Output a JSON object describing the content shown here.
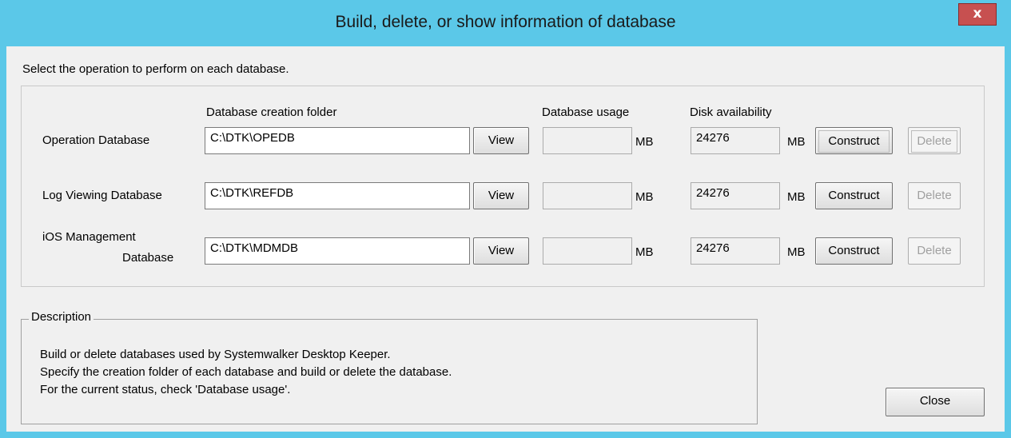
{
  "window": {
    "title": "Build, delete, or show information of database",
    "close_glyph": "x"
  },
  "instruction": "Select the operation to perform on each database.",
  "columns": {
    "folder": "Database creation folder",
    "usage": "Database usage",
    "disk": "Disk availability"
  },
  "rows": [
    {
      "label_line1": "Operation Database",
      "label_line2": "",
      "folder": "C:\\DTK\\OPEDB",
      "view_label": "View",
      "usage": "",
      "usage_unit": "MB",
      "disk": "24276",
      "disk_unit": "MB",
      "construct_label": "Construct",
      "delete_label": "Delete"
    },
    {
      "label_line1": "Log Viewing Database",
      "label_line2": "",
      "folder": "C:\\DTK\\REFDB",
      "view_label": "View",
      "usage": "",
      "usage_unit": "MB",
      "disk": "24276",
      "disk_unit": "MB",
      "construct_label": "Construct",
      "delete_label": "Delete"
    },
    {
      "label_line1": "iOS Management",
      "label_line2": "Database",
      "folder": "C:\\DTK\\MDMDB",
      "view_label": "View",
      "usage": "",
      "usage_unit": "MB",
      "disk": "24276",
      "disk_unit": "MB",
      "construct_label": "Construct",
      "delete_label": "Delete"
    }
  ],
  "description": {
    "legend": "Description",
    "lines": [
      "Build or delete databases used by Systemwalker Desktop Keeper.",
      "Specify the creation folder of each database and build or delete the database.",
      "For the current status, check 'Database usage'."
    ]
  },
  "close_label": "Close",
  "colors": {
    "title_bar": "#5bc8e8",
    "client_bg": "#f0f0f0",
    "close_x_bg": "#c75050"
  }
}
